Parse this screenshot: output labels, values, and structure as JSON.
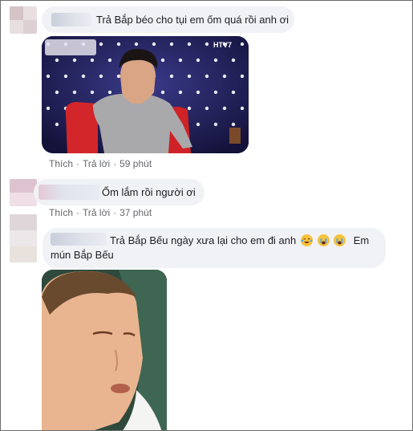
{
  "comments": [
    {
      "text": "Trả Bắp béo cho tụi em ốm quá rồi anh ơi",
      "channel_logo": "HTV7",
      "actions": {
        "like": "Thích",
        "reply": "Trả lời",
        "time": "59 phút"
      }
    },
    {
      "text": "Ốm lắm rồi người ơi",
      "actions": {
        "like": "Thích",
        "reply": "Trả lời",
        "time": "37 phút"
      }
    },
    {
      "text_line1": "Trả Bắp Bếu ngày xưa lại cho em đi anh",
      "text_line1_tail": "Em",
      "text_line2": "mún Bắp Bếu",
      "emojis": [
        "laughing-tears-emoji",
        "crying-emoji",
        "crying-emoji"
      ]
    }
  ],
  "colors": {
    "bubble": "#f0f2f5",
    "meta": "#65676b",
    "text": "#1c1e21"
  }
}
